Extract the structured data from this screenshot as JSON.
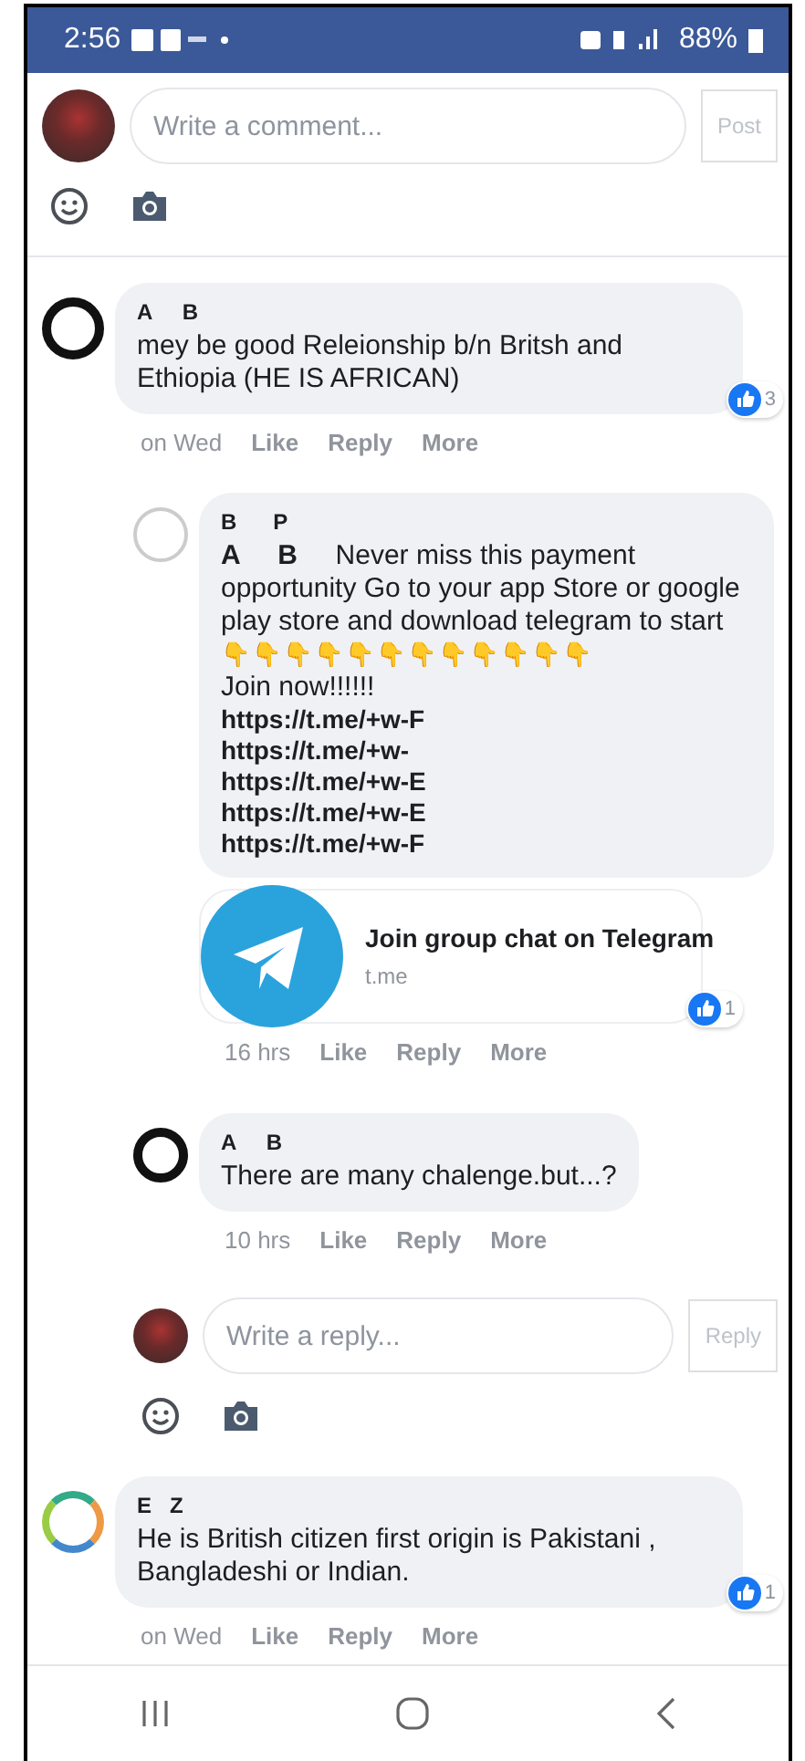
{
  "status_bar": {
    "time": "2:56",
    "battery": "88%"
  },
  "composer": {
    "placeholder": "Write a comment...",
    "button": "Post"
  },
  "comments": [
    {
      "author": "A     B",
      "avatar": {
        "kind": "dark"
      },
      "text": "mey be good Releionship b/n Britsh and Ethiopia (HE IS AFRICAN)",
      "likes": "3",
      "time": "on Wed",
      "actions": [
        "Like",
        "Reply",
        "More"
      ],
      "replies": [
        {
          "author": "B      P",
          "avatar": {
            "kind": "light"
          },
          "lines": [
            {
              "kind": "text",
              "text": "**A     B**     Never miss this payment opportunity Go to your app Store or google play store and download telegram to start"
            },
            {
              "kind": "emoji",
              "text": "👇👇👇👇👇👇👇👇👇👇👇👇"
            },
            {
              "kind": "text",
              "text": "Join now!!!!!!"
            },
            {
              "kind": "link",
              "text": "https://t.me/+w-F"
            },
            {
              "kind": "link",
              "text": "https://t.me/+w-"
            },
            {
              "kind": "link",
              "text": "https://t.me/+w-E"
            },
            {
              "kind": "link",
              "text": "https://t.me/+w-E"
            },
            {
              "kind": "link",
              "text": "https://t.me/+w-F"
            }
          ],
          "preview": {
            "title": "Join group chat on Telegram",
            "domain": "t.me",
            "likes": "1"
          },
          "time": "16 hrs",
          "actions": [
            "Like",
            "Reply",
            "More"
          ]
        },
        {
          "author": "A     B",
          "avatar": {
            "kind": "dark"
          },
          "lines": [
            {
              "kind": "text",
              "text": "There are many chalenge.but...?"
            }
          ],
          "time": "10 hrs",
          "actions": [
            "Like",
            "Reply",
            "More"
          ]
        }
      ],
      "reply_composer": {
        "placeholder": "Write a reply...",
        "button": "Reply"
      }
    },
    {
      "author": "E   Z",
      "avatar": {
        "kind": "colorful"
      },
      "text": "He is British citizen first origin is Pakistani , Bangladeshi or Indian.",
      "likes": "1",
      "time": "on Wed",
      "actions": [
        "Like",
        "Reply",
        "More"
      ]
    }
  ]
}
